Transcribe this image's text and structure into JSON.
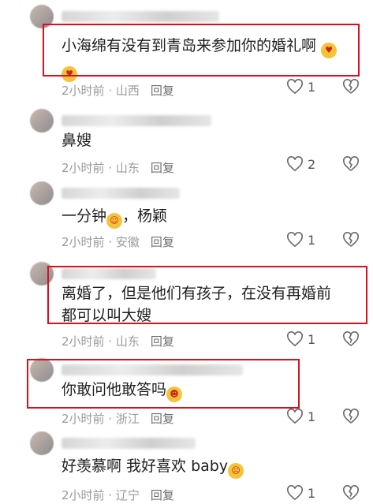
{
  "comments": [
    {
      "text": "小海绵有没有到青岛来参加你的婚礼啊",
      "emoji": "heart-eyes-face",
      "time": "2小时前",
      "region": "山西",
      "reply": "回复",
      "likes": "1"
    },
    {
      "text": "鼻嫂",
      "time": "2小时前",
      "region": "山东",
      "reply": "回复",
      "likes": "2"
    },
    {
      "text": "一分钟",
      "emoji": "cheering-face",
      "text_after": "，杨颖",
      "time": "2小时前",
      "region": "安徽",
      "reply": "回复",
      "likes": "1"
    },
    {
      "text_line1": "离婚了，但是他们有孩子，在没有再婚前",
      "text_line2": "都可以叫大嫂",
      "time": "2小时前",
      "region": "山东",
      "reply": "回复",
      "likes": "1"
    },
    {
      "text": "你敢问他敢答吗",
      "emoji": "laughing-face",
      "time": "2小时前",
      "region": "浙江",
      "reply": "回复",
      "likes": "1"
    },
    {
      "text": "好羡慕啊 我好喜欢 baby",
      "emoji": "crying-face",
      "time": "2小时前",
      "region": "辽宁",
      "reply": "回复",
      "likes": "1"
    }
  ],
  "colors": {
    "highlight": "#d9101e",
    "meta": "#9a9a9a"
  }
}
